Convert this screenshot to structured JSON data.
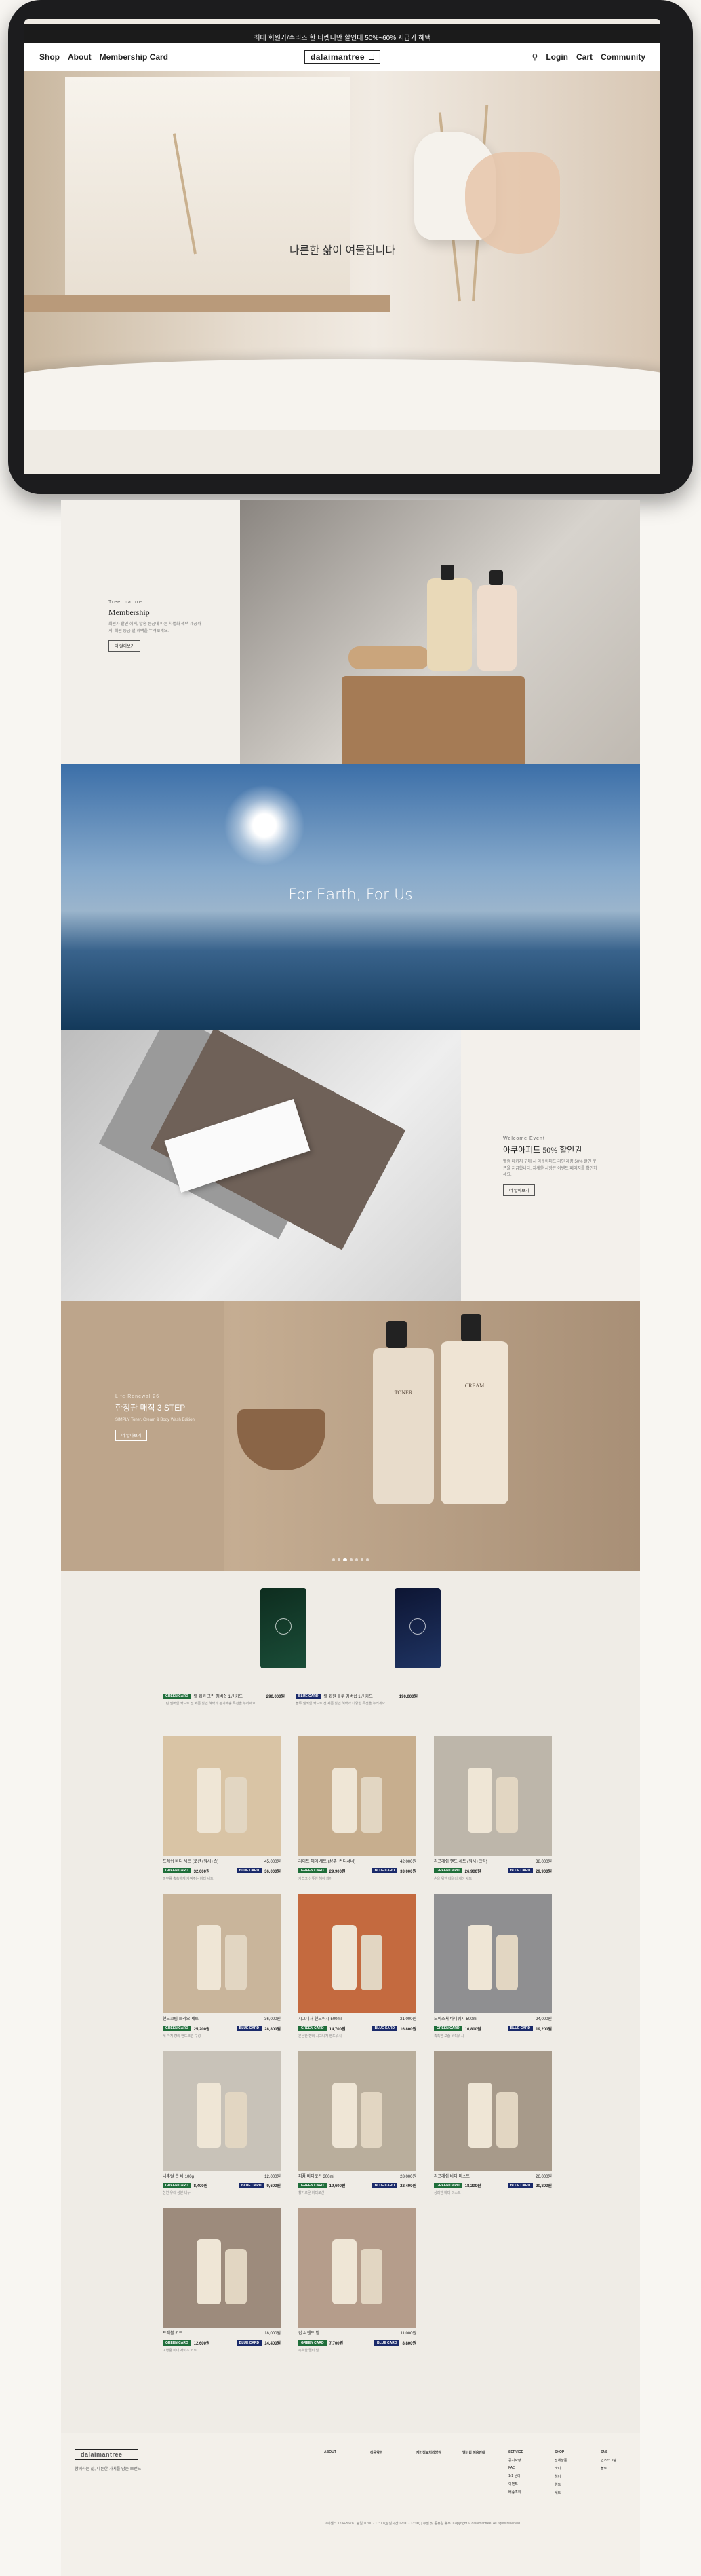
{
  "announcement": "최대 회원가/수리즈 한 티켓니만 할인대 50%~60% 지급가 혜택",
  "nav": {
    "left": [
      "Shop",
      "About",
      "Membership Card"
    ],
    "logo": "dalaimantree",
    "right": [
      "Login",
      "Cart",
      "Community"
    ]
  },
  "hero": {
    "text": "나른한 삶이 여물집니다"
  },
  "section_membership": {
    "eyebrow": "Tree. nature",
    "title": "Membership",
    "desc": "회원가 할인 혜택, 발송 등급에 따른 차별화 혜택 제공까지, 회원 등급 별 혜택을 누려보세요.",
    "button": "더 알아보기"
  },
  "section_earth": {
    "text": "For Earth, For Us"
  },
  "section_welcome": {
    "eyebrow": "Welcome Event",
    "title": "아쿠아퍼드 50% 할인권",
    "desc": "웰컴 패키지 구매 시 아쿠아퍼드 라인 제품 50% 할인 쿠폰을 지급합니다. 자세한 사항은 이벤트 페이지를 확인하세요.",
    "button": "더 알아보기"
  },
  "section_skincare": {
    "eyebrow": "Life Renewal 26",
    "title": "한정판 매직 3 STEP",
    "desc": "SIMPLY Toner, Cream & Body Wash Edition",
    "button": "더 알아보기",
    "bottle1": "TONER",
    "bottle2": "CREAM"
  },
  "carousel": {
    "count": 7,
    "active": 2
  },
  "member_cards": [
    {
      "tag": "GREEN CARD",
      "name": "웰 회원 그린 멤버쉽 1년 카드",
      "price": "290,000원",
      "desc": "그린 멤버쉽 카드로 전 제품 할인 혜택과 정기배송 특전을 누리세요."
    },
    {
      "tag": "BLUE CARD",
      "name": "웰 회원 블루 멤버쉽 1년 카드",
      "price": "190,000원",
      "desc": "블루 멤버쉽 카드로 전 제품 할인 혜택과 다양한 특전을 누리세요."
    }
  ],
  "products": [
    {
      "name": "프레쉬 바디 세트 (로션+워시+솝)",
      "price": "45,000원",
      "green": "32,000원",
      "blue": "36,000원",
      "desc": "피부를 촉촉하게 가꿔주는 바디 세트",
      "bg": "#d9c4a5"
    },
    {
      "name": "라이트 헤어 세트 (샴푸+컨디셔너)",
      "price": "42,000원",
      "green": "29,900원",
      "blue": "33,000원",
      "desc": "가볍고 산뜻한 헤어 케어",
      "bg": "#c7ae8e"
    },
    {
      "name": "리프레쉬 핸드 세트 (워시+크림)",
      "price": "38,000원",
      "green": "26,900원",
      "blue": "29,900원",
      "desc": "손을 위한 데일리 케어 세트",
      "bg": "#bdb6aa"
    },
    {
      "name": "핸드크림 트리오 세트",
      "price": "36,000원",
      "green": "25,200원",
      "blue": "28,800원",
      "desc": "세 가지 향의 핸드크림 구성",
      "bg": "#c9b59b"
    },
    {
      "name": "시그니처 핸드워시 500ml",
      "price": "21,000원",
      "green": "14,700원",
      "blue": "16,800원",
      "desc": "은은한 향의 시그니처 핸드워시",
      "bg": "#c46a3f"
    },
    {
      "name": "모이스처 바디워시 500ml",
      "price": "24,000원",
      "green": "16,800원",
      "blue": "19,200원",
      "desc": "촉촉한 보습 바디워시",
      "bg": "#8f8f91"
    },
    {
      "name": "내추럴 솝 바 100g",
      "price": "12,000원",
      "green": "8,400원",
      "blue": "9,600원",
      "desc": "천연 유래 성분 비누",
      "bg": "#c8c2b8"
    },
    {
      "name": "퍼퓸 바디로션 300ml",
      "price": "28,000원",
      "green": "19,600원",
      "blue": "22,400원",
      "desc": "향기로운 바디로션",
      "bg": "#b9ae9c"
    },
    {
      "name": "리프레쉬 바디 미스트",
      "price": "26,000원",
      "green": "18,200원",
      "blue": "20,800원",
      "desc": "상쾌한 바디 미스트",
      "bg": "#a79a8a"
    },
    {
      "name": "트래블 키트",
      "price": "18,000원",
      "green": "12,600원",
      "blue": "14,400원",
      "desc": "여행용 미니 사이즈 키트",
      "bg": "#9d8b7c"
    },
    {
      "name": "립 & 핸드 밤",
      "price": "11,000원",
      "green": "7,700원",
      "blue": "8,800원",
      "desc": "촉촉한 멀티 밤",
      "bg": "#b59d8b"
    }
  ],
  "footer": {
    "logo": "dalaimantree",
    "tagline": "함께하는 삶, 나른한 가치를 담는 브랜드",
    "cols": [
      {
        "h": "ABOUT",
        "items": []
      },
      {
        "h": "이용약관",
        "items": []
      },
      {
        "h": "개인정보처리방침",
        "items": []
      },
      {
        "h": "멤버쉽 이용안내",
        "items": []
      },
      {
        "h": "SERVICE",
        "items": [
          "공지사항",
          "FAQ",
          "1:1 문의",
          "이벤트",
          "배송조회"
        ]
      },
      {
        "h": "SHOP",
        "items": [
          "전체상품",
          "바디",
          "헤어",
          "핸드",
          "세트"
        ]
      },
      {
        "h": "SNS",
        "items": [
          "인스타그램",
          "블로그"
        ]
      }
    ],
    "legal": "고객센터 1234-5678 | 평일 10:00 - 17:00 (점심시간 12:00 - 13:00) | 주말 및 공휴일 휴무. Copyright © dalaimantree. All rights reserved."
  }
}
